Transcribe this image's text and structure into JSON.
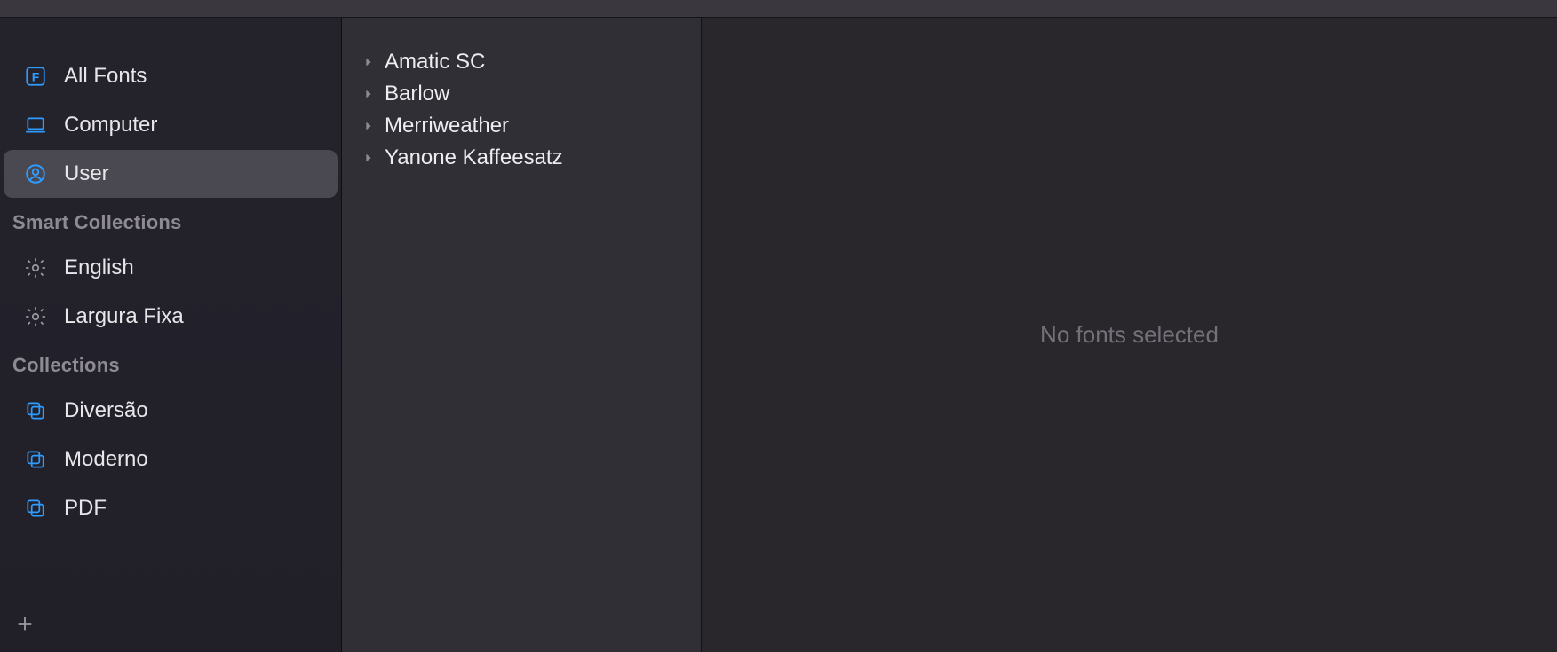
{
  "sidebar": {
    "library": [
      {
        "id": "all-fonts",
        "label": "All Fonts",
        "icon": "font-icon",
        "selected": false
      },
      {
        "id": "computer",
        "label": "Computer",
        "icon": "laptop-icon",
        "selected": false
      },
      {
        "id": "user",
        "label": "User",
        "icon": "user-icon",
        "selected": true
      }
    ],
    "smart_header": "Smart Collections",
    "smart": [
      {
        "id": "english",
        "label": "English",
        "icon": "gear-icon"
      },
      {
        "id": "largura-fixa",
        "label": "Largura Fixa",
        "icon": "gear-icon"
      }
    ],
    "collections_header": "Collections",
    "collections": [
      {
        "id": "diversao",
        "label": "Diversão",
        "icon": "collection-icon"
      },
      {
        "id": "moderno",
        "label": "Moderno",
        "icon": "collection-icon"
      },
      {
        "id": "pdf",
        "label": "PDF",
        "icon": "collection-icon"
      }
    ]
  },
  "fonts": [
    {
      "name": "Amatic SC"
    },
    {
      "name": "Barlow"
    },
    {
      "name": "Merriweather"
    },
    {
      "name": "Yanone Kaffeesatz"
    }
  ],
  "preview": {
    "placeholder": "No fonts selected"
  }
}
